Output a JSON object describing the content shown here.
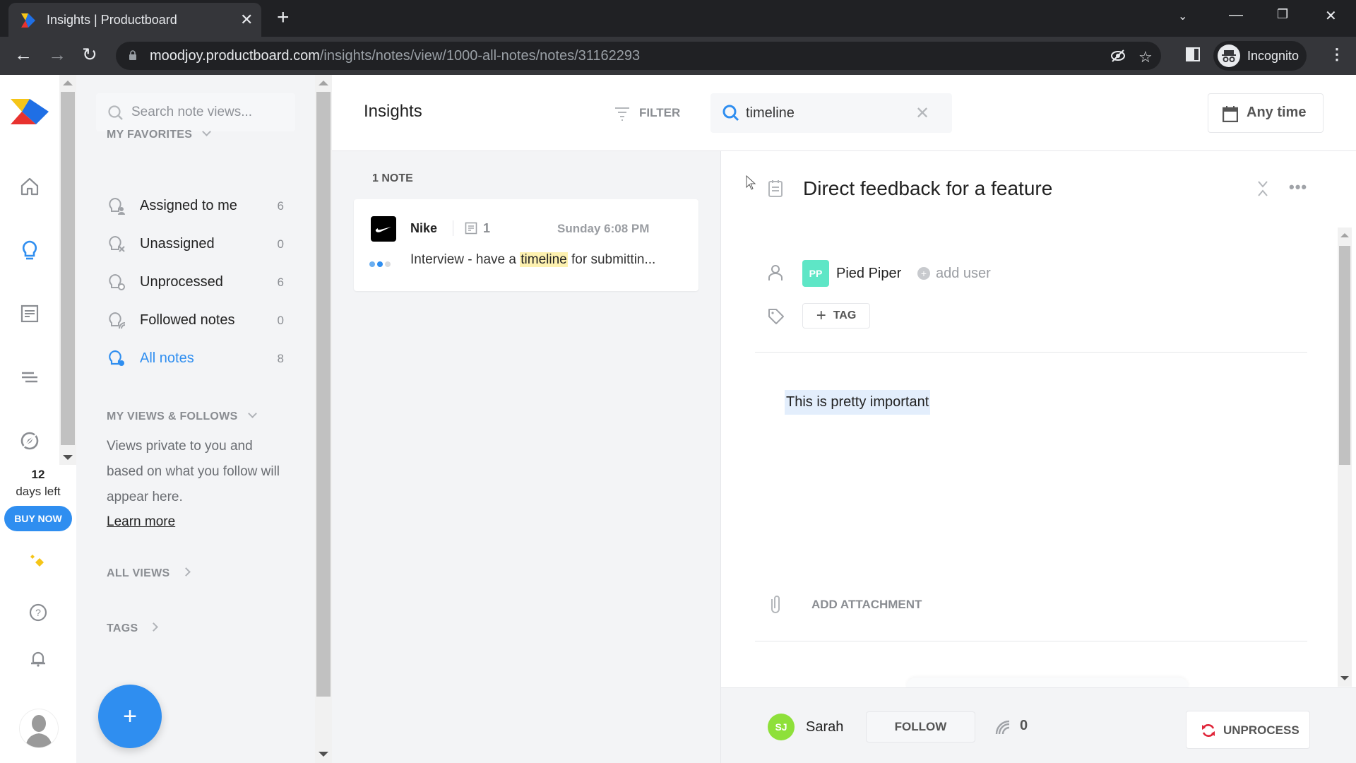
{
  "browser": {
    "tab_title": "Insights | Productboard",
    "url_host": "moodjoy.productboard.com",
    "url_path": "/insights/notes/view/1000-all-notes/notes/31162293",
    "profile_label": "Incognito"
  },
  "rail": {
    "trial_days": "12",
    "trial_label": "days left",
    "buy_label": "BUY NOW"
  },
  "sidebar": {
    "search_placeholder": "Search note views...",
    "favorites_title": "MY FAVORITES",
    "favorites": [
      {
        "label": "Assigned to me",
        "count": "6"
      },
      {
        "label": "Unassigned",
        "count": "0"
      },
      {
        "label": "Unprocessed",
        "count": "6"
      },
      {
        "label": "Followed notes",
        "count": "0"
      },
      {
        "label": "All notes",
        "count": "8",
        "active": true
      }
    ],
    "views_title": "MY VIEWS & FOLLOWS",
    "views_description": "Views private to you and based on what you follow will appear here.",
    "learn_more": "Learn more",
    "all_views": "ALL VIEWS",
    "tags": "TAGS",
    "add_button": "+"
  },
  "header": {
    "title": "Insights",
    "filter_label": "FILTER",
    "search_value": "timeline",
    "date_filter": "Any time"
  },
  "list": {
    "count_label": "1 NOTE",
    "notes": [
      {
        "company": "Nike",
        "doc_count": "1",
        "date": "Sunday 6:08 PM",
        "snippet_before": "Interview - have a ",
        "snippet_highlight": "timeline",
        "snippet_after": " for submittin..."
      }
    ]
  },
  "detail": {
    "title": "Direct feedback for a feature",
    "company_initials": "PP",
    "company_name": "Pied Piper",
    "add_user": "add user",
    "tag_button": "TAG",
    "body": "This is pretty important",
    "add_attachment": "ADD ATTACHMENT",
    "owner_initials": "SJ",
    "owner_name": "Sarah",
    "follow_label": "FOLLOW",
    "followers_count": "0",
    "unprocess_label": "UNPROCESS"
  },
  "colors": {
    "accent": "#2f8ef0",
    "company_badge": "#5ee6c6",
    "owner_badge": "#8ee03a",
    "highlight": "#fdf1b0",
    "unprocess_icon": "#e0263a"
  }
}
